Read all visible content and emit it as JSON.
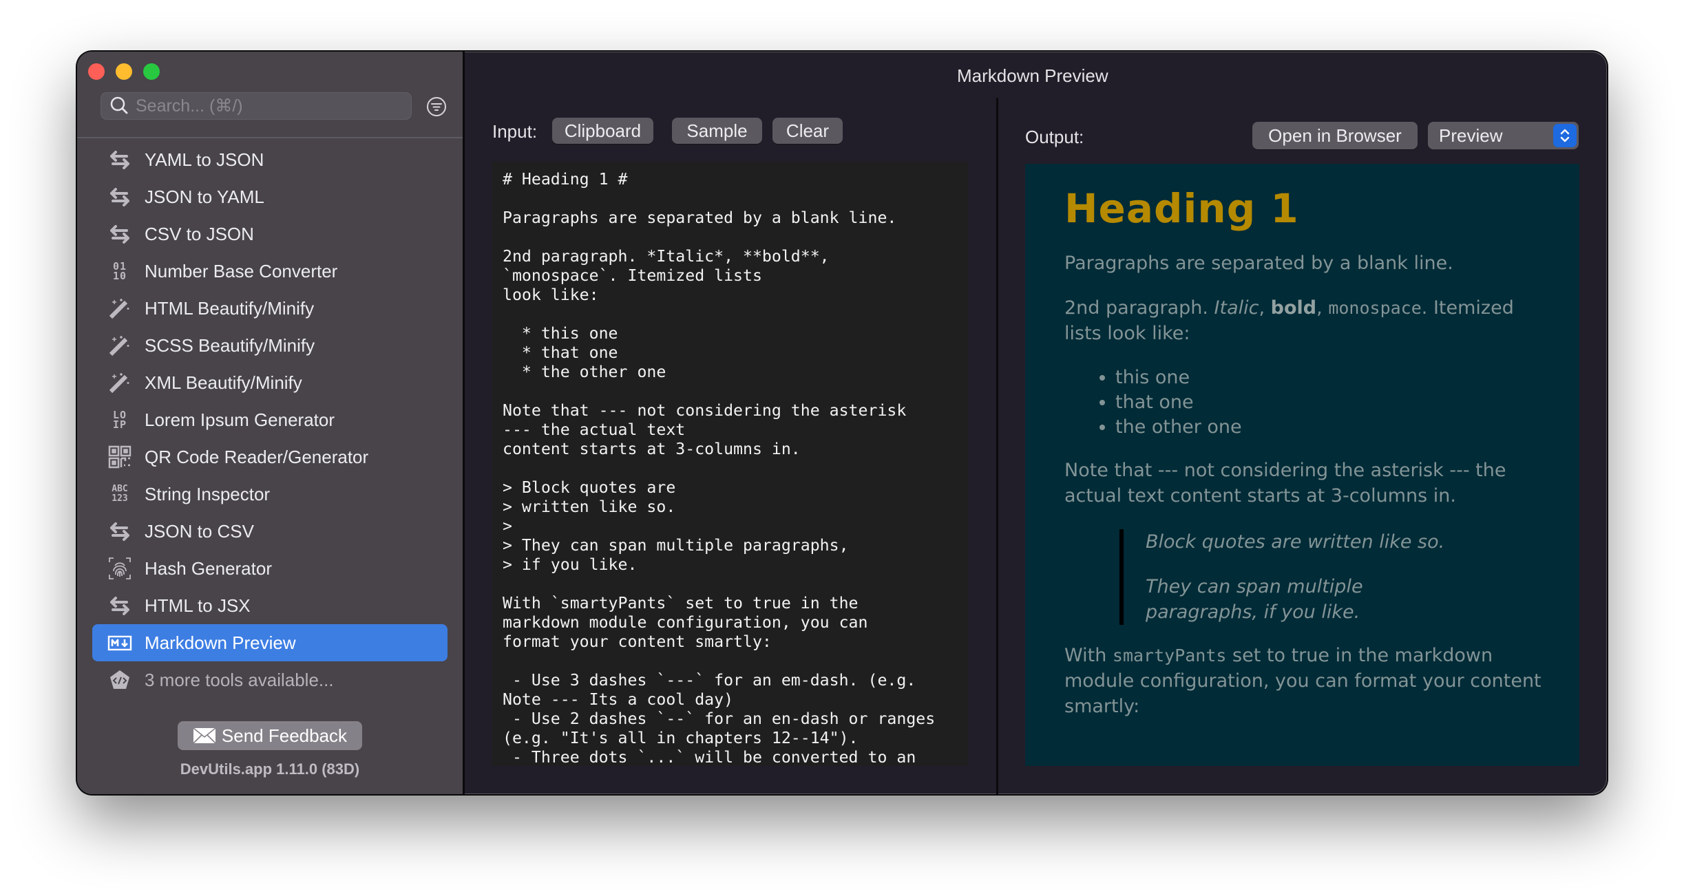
{
  "window": {
    "title": "Markdown Preview"
  },
  "sidebar": {
    "search_placeholder": "Search... (⌘/)",
    "filter_icon": "filter-circle-icon",
    "items": [
      {
        "label": "YAML to JSON",
        "icon": "arrows-swap-icon"
      },
      {
        "label": "JSON to YAML",
        "icon": "arrows-swap-icon"
      },
      {
        "label": "CSV to JSON",
        "icon": "arrows-swap-icon"
      },
      {
        "label": "Number Base Converter",
        "icon": "binary-digits-icon",
        "glyph": "01\n10"
      },
      {
        "label": "HTML Beautify/Minify",
        "icon": "magic-wand-icon"
      },
      {
        "label": "SCSS Beautify/Minify",
        "icon": "magic-wand-icon"
      },
      {
        "label": "XML Beautify/Minify",
        "icon": "magic-wand-icon"
      },
      {
        "label": "Lorem Ipsum Generator",
        "icon": "lorem-ipsum-icon",
        "glyph": "LO\nIP"
      },
      {
        "label": "QR Code Reader/Generator",
        "icon": "qr-code-icon"
      },
      {
        "label": "String Inspector",
        "icon": "abc-123-icon",
        "glyph": "ABC\n123"
      },
      {
        "label": "JSON to CSV",
        "icon": "arrows-swap-icon"
      },
      {
        "label": "Hash Generator",
        "icon": "fingerprint-icon"
      },
      {
        "label": "HTML to JSX",
        "icon": "arrows-swap-icon"
      },
      {
        "label": "Markdown Preview",
        "icon": "markdown-icon",
        "active": true
      }
    ],
    "more_tools": "3 more tools available...",
    "feedback_label": "Send Feedback",
    "version": "DevUtils.app 1.11.0 (83D)"
  },
  "input": {
    "label": "Input:",
    "buttons": {
      "clipboard": "Clipboard",
      "sample": "Sample",
      "clear": "Clear"
    },
    "text": "# Heading 1 #\n\nParagraphs are separated by a blank line.\n\n2nd paragraph. *Italic*, **bold**,\n`monospace`. Itemized lists\nlook like:\n\n  * this one\n  * that one\n  * the other one\n\nNote that --- not considering the asterisk\n--- the actual text\ncontent starts at 3-columns in.\n\n> Block quotes are\n> written like so.\n>\n> They can span multiple paragraphs,\n> if you like.\n\nWith `smartyPants` set to true in the\nmarkdown module configuration, you can\nformat your content smartly:\n\n - Use 3 dashes `---` for an em-dash. (e.g.\nNote --- Its a cool day)\n - Use 2 dashes `--` for an en-dash or ranges\n(e.g. \"It's all in chapters 12--14\").\n - Three dots `...` will be converted to an"
  },
  "output": {
    "label": "Output:",
    "open_in_browser": "Open in Browser",
    "mode_selected": "Preview",
    "colors": {
      "background": "#002b36",
      "heading": "#b58900",
      "text": "#839496"
    },
    "preview": {
      "h1": "Heading 1",
      "p1": "Paragraphs are separated by a blank line.",
      "p2_start": "2nd paragraph. ",
      "p2_italic": "Italic",
      "p2_sep1": ", ",
      "p2_bold": "bold",
      "p2_sep2": ", ",
      "p2_code": "monospace",
      "p2_end": ". Itemized lists look like:",
      "list": [
        "this one",
        "that one",
        "the other one"
      ],
      "p3": "Note that --- not considering the asterisk --- the actual text content starts at 3-columns in.",
      "quote1": "Block quotes are written like so.",
      "quote2": "They can span multiple paragraphs, if you like.",
      "p4_start": "With ",
      "p4_code": "smartyPants",
      "p4_end": " set to true in the markdown module configuration, you can format your content smartly:"
    }
  }
}
